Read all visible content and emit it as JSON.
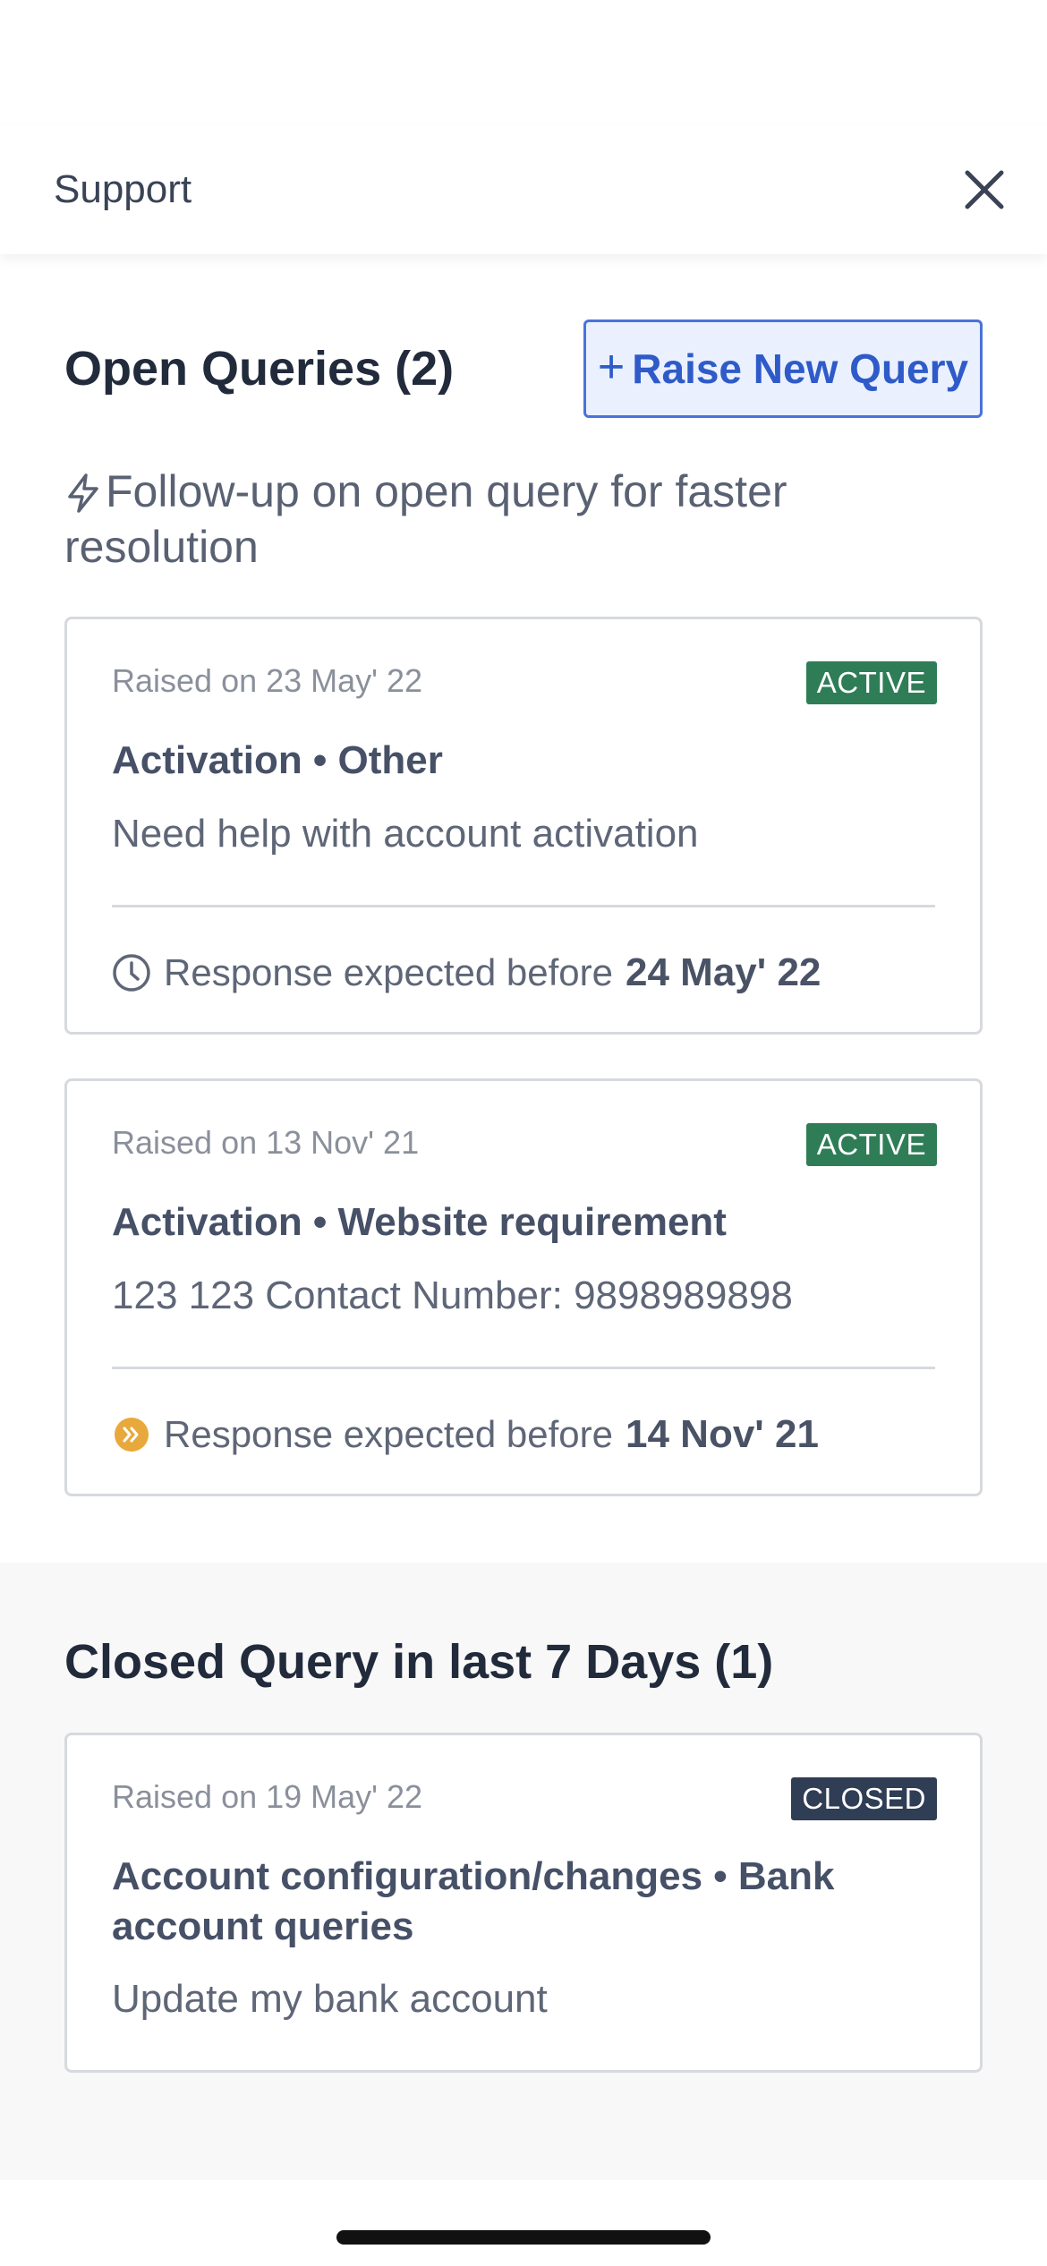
{
  "header": {
    "title": "Support"
  },
  "open": {
    "title": "Open Queries (2)",
    "raise_button_plus": "+",
    "raise_button_label": "Raise New Query",
    "hint": "Follow-up on open query for faster resolution"
  },
  "open_cards": [
    {
      "raised": "Raised on 23 May' 22",
      "status": "ACTIVE",
      "title": "Activation • Other",
      "description": "Need help with account activation",
      "response_label": "Response expected before",
      "response_date": "24 May' 22",
      "icon": "clock-icon"
    },
    {
      "raised": "Raised on 13 Nov' 21",
      "status": "ACTIVE",
      "title": "Activation • Website requirement",
      "description": "123 123 Contact Number: 9898989898",
      "response_label": "Response expected before",
      "response_date": "14 Nov' 21",
      "icon": "overdue-chevrons-icon"
    }
  ],
  "closed": {
    "title": "Closed Query in last 7 Days (1)",
    "cards": [
      {
        "raised": "Raised on 19 May' 22",
        "status": "CLOSED",
        "title": "Account configuration/changes • Bank account queries",
        "description": "Update my bank account"
      }
    ]
  },
  "colors": {
    "accent": "#2f5bc9",
    "active_badge": "#2f7d57",
    "closed_badge": "#2f3d55",
    "overdue_icon": "#e8a93c"
  }
}
